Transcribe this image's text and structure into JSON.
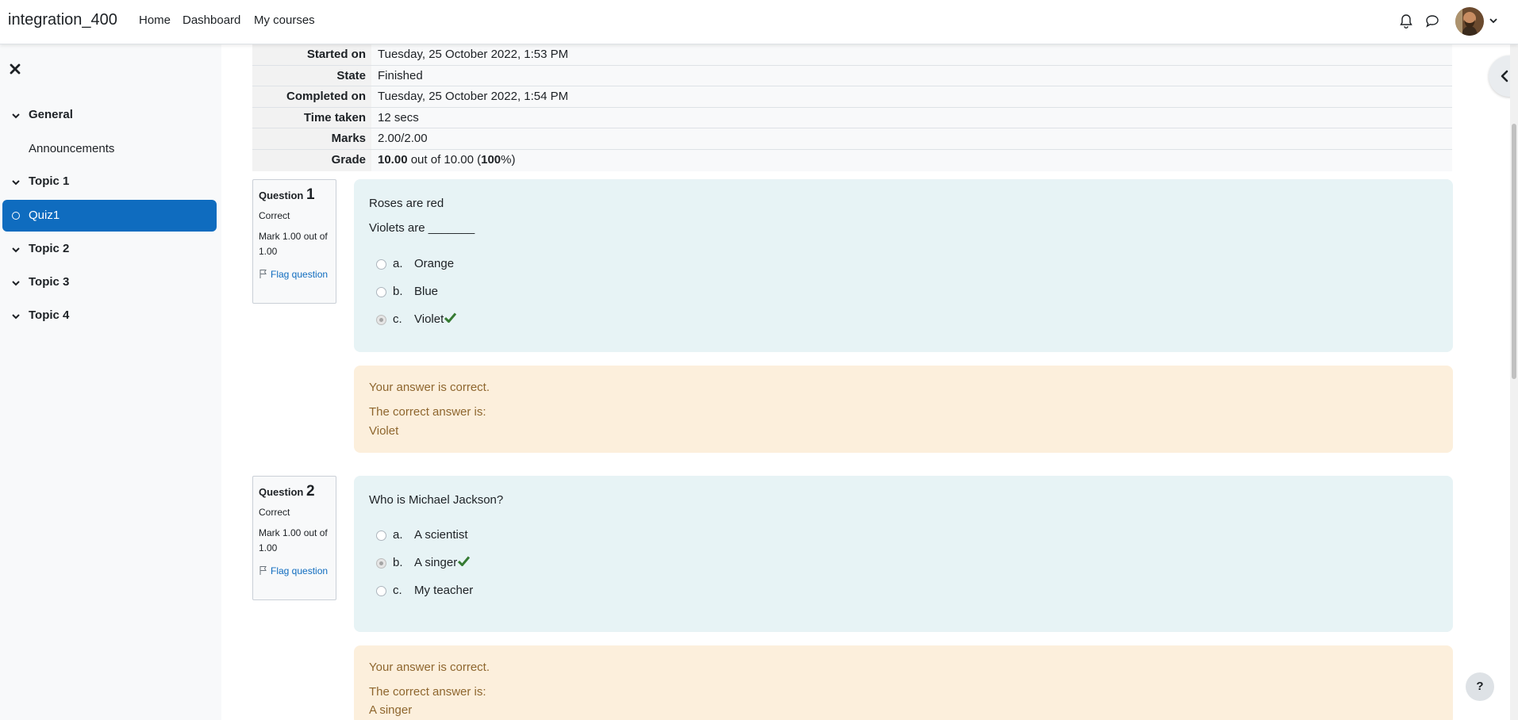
{
  "navbar": {
    "brand": "integration_400",
    "links": [
      "Home",
      "Dashboard",
      "My courses"
    ],
    "icons": [
      "bell-icon",
      "chat-icon"
    ]
  },
  "sidebar": {
    "sections": [
      {
        "label": "General"
      },
      {
        "label": "Topic 1"
      },
      {
        "label": "Topic 2"
      },
      {
        "label": "Topic 3"
      },
      {
        "label": "Topic 4"
      }
    ],
    "items": [
      {
        "label": "Announcements"
      },
      {
        "label": "Quiz1",
        "active": true
      }
    ]
  },
  "summary": [
    {
      "k": "Started on",
      "v": "Tuesday, 25 October 2022, 1:53 PM"
    },
    {
      "k": "State",
      "v": "Finished"
    },
    {
      "k": "Completed on",
      "v": "Tuesday, 25 October 2022, 1:54 PM"
    },
    {
      "k": "Time taken",
      "v": "12 secs"
    },
    {
      "k": "Marks",
      "v": "2.00/2.00"
    },
    {
      "k": "Grade",
      "grade": "10.00",
      "mid": " out of 10.00 (",
      "pct": "100",
      "end": "%)"
    }
  ],
  "questions": [
    {
      "label": "Question",
      "number": "1",
      "status": "Correct",
      "mark": "Mark 1.00 out of 1.00",
      "flag": "Flag question",
      "text1": "Roses are red",
      "text2": "Violets are _______",
      "answers": [
        {
          "letter": "a.",
          "text": "Orange"
        },
        {
          "letter": "b.",
          "text": "Blue"
        },
        {
          "letter": "c.",
          "text": "Violet",
          "selected": true
        }
      ],
      "feedback": "Your answer is correct.",
      "correct_label": "The correct answer is:",
      "correct_answer": "Violet"
    },
    {
      "label": "Question",
      "number": "2",
      "status": "Correct",
      "mark": "Mark 1.00 out of 1.00",
      "flag": "Flag question",
      "text1": "Who is Michael Jackson?",
      "answers": [
        {
          "letter": "a.",
          "text": "A scientist"
        },
        {
          "letter": "b.",
          "text": "A singer",
          "selected": true
        },
        {
          "letter": "c.",
          "text": "My teacher"
        }
      ],
      "feedback": "Your answer is correct.",
      "correct_label": "The correct answer is:",
      "correct_answer": "A singer"
    }
  ],
  "help": "?",
  "colors": {
    "primary": "#0f6cbf",
    "correct": "#357a32",
    "outcome_bg": "#fcefdc",
    "formulation_bg": "#e7f3f5"
  }
}
